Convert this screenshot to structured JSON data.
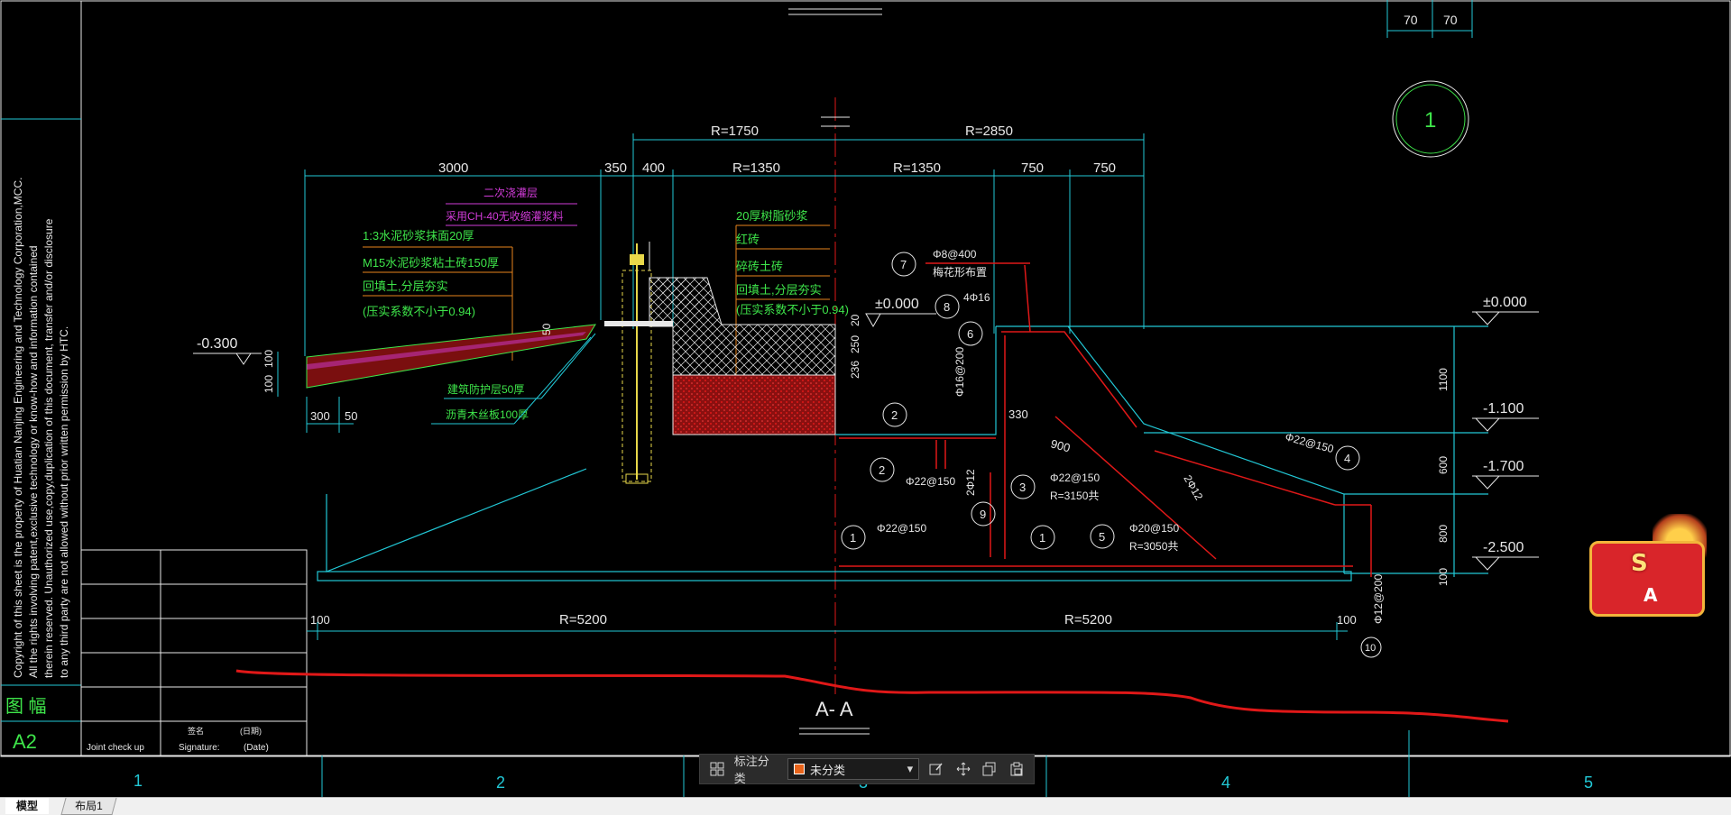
{
  "drawing": {
    "section_title": "A- A",
    "dims_top_right": [
      "70",
      "70"
    ],
    "detail_number": "1",
    "radius_top_left": "R=1750",
    "radius_top_right": "R=2850",
    "dims_row2": [
      "3000",
      "350",
      "400",
      "R=1350",
      "R=1350",
      "750",
      "750"
    ],
    "dims_bottom": [
      "100",
      "R=5200",
      "R=5200",
      "100"
    ],
    "dims_left_small": [
      "300",
      "50",
      "100",
      "100"
    ],
    "dim_50": "50",
    "dims_mid_vertical": [
      "236",
      "250",
      "20"
    ],
    "dim_330": "330",
    "dim_900": "900",
    "dims_right_vertical": [
      "1100",
      "600",
      "800",
      "100"
    ],
    "levels": [
      "-0.300",
      "±0.000",
      "±0.000",
      "-1.100",
      "-1.700",
      "-2.500"
    ],
    "left_notes": [
      "1:3水泥砂浆抹面20厚",
      "M15水泥砂浆粘土砖150厚",
      "回填土,分层夯实",
      "(压实系数不小于0.94)"
    ],
    "top_magenta_notes": [
      "二次浇灌层",
      "采用CH-40无收缩灌浆料"
    ],
    "right_notes": [
      "20厚树脂砂浆",
      "红砖",
      "碎砖土砖",
      "回填土,分层夯实",
      "(压实系数不小于0.94)"
    ],
    "bottom_left_notes": [
      "建筑防护层50厚",
      "沥青木丝板100厚"
    ],
    "rebar_labels": [
      "Φ8@400",
      "梅花形布置",
      "4Φ16",
      "Φ16@200",
      "Φ22@150",
      "2Φ12",
      "Φ22@150",
      "R=3150共",
      "Φ22@150",
      "Φ20@150",
      "R=3050共",
      "Φ22@150",
      "Φ12@200",
      "2Φ12"
    ],
    "rebar_marks": [
      "7",
      "8",
      "6",
      "2",
      "2",
      "3",
      "9",
      "1",
      "1",
      "5",
      "4",
      "10"
    ],
    "copyright_lines": [
      "Copyright of this sheet is the property of Huatian Nanjing Engineering and Technology Corporation,MCC.",
      "All the rights involving patent,exclusive technology or know-how and information contained",
      "therein reserved. Unauthorized use,copy,duplication of this document, transfer and/or disclosure",
      "to any third party are not allowed without prior written permission by HTC."
    ],
    "frame_size": "A2",
    "frame_label": "图 幅",
    "title_block": {
      "joint_check": "Joint check up",
      "signature_cn": "签名",
      "signature": "Signature:",
      "date_cn": "(日期)",
      "date": "(Date)"
    },
    "grid_numbers": [
      "1",
      "2",
      "3",
      "4",
      "5"
    ]
  },
  "toolbar": {
    "label": "标注分类",
    "select_value": "未分类"
  },
  "tabs": {
    "model": "模型",
    "layout1": "布局1"
  },
  "badge": {
    "letter": "S",
    "text": "A"
  },
  "colors": {
    "cyan": "#22c8d6",
    "green": "#3ee54a",
    "yellow": "#e8d84a",
    "red": "#e01818",
    "magenta": "#d13bd8",
    "white": "#e8e8e8",
    "orange": "#e8641b"
  }
}
